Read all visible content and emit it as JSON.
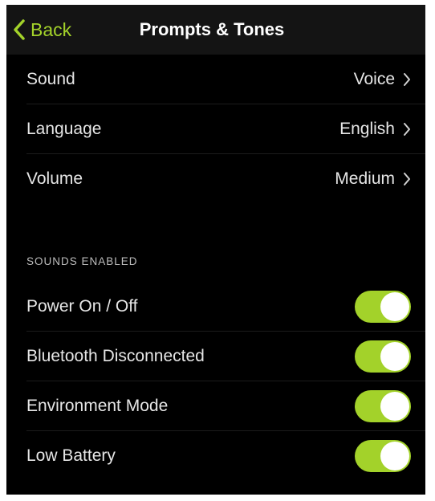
{
  "nav": {
    "back_label": "Back",
    "title": "Prompts & Tones"
  },
  "settings": [
    {
      "label": "Sound",
      "value": "Voice"
    },
    {
      "label": "Language",
      "value": "English"
    },
    {
      "label": "Volume",
      "value": "Medium"
    }
  ],
  "sounds_section": {
    "header": "SOUNDS ENABLED",
    "items": [
      {
        "label": "Power On / Off",
        "enabled": true
      },
      {
        "label": "Bluetooth Disconnected",
        "enabled": true
      },
      {
        "label": "Environment Mode",
        "enabled": true
      },
      {
        "label": "Low Battery",
        "enabled": true
      }
    ]
  },
  "colors": {
    "accent": "#a3d22a",
    "background": "#000000",
    "navbar": "#141414"
  },
  "icons": {
    "back": "chevron-left-icon",
    "row": "chevron-right-icon"
  }
}
